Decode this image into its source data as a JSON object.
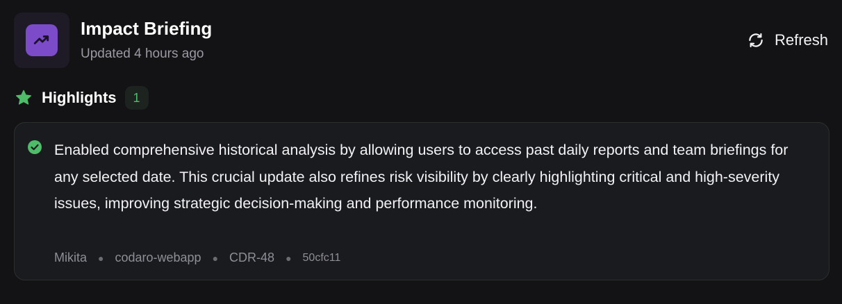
{
  "header": {
    "title": "Impact Briefing",
    "subtitle": "Updated 4 hours ago",
    "refresh_label": "Refresh",
    "app_icon": "trending-up-icon"
  },
  "highlights": {
    "title": "Highlights",
    "count": "1",
    "icon": "star-icon",
    "items": [
      {
        "text": "Enabled comprehensive historical analysis by allowing users to access past daily reports and team briefings for any selected date. This crucial update also refines risk visibility by clearly highlighting critical and high-severity issues, improving strategic decision-making and performance monitoring.",
        "author": "Mikita",
        "repo": "codaro-webapp",
        "ticket": "CDR-48",
        "commit": "50cfc11",
        "icon": "check-circle-icon"
      }
    ]
  },
  "colors": {
    "background": "#131316",
    "accent_purple": "#7c4bc9",
    "accent_green": "#4dbd6a",
    "card_background": "#1a1b1e"
  }
}
